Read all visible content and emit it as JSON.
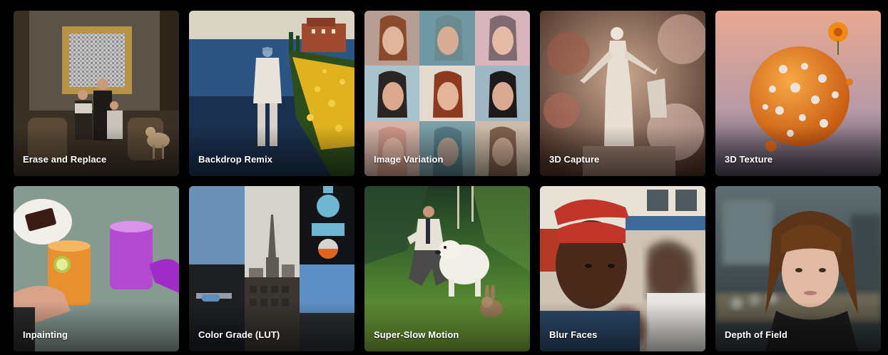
{
  "tools": [
    {
      "label": "Erase and Replace"
    },
    {
      "label": "Backdrop Remix"
    },
    {
      "label": "Image Variation"
    },
    {
      "label": "3D Capture"
    },
    {
      "label": "3D Texture"
    },
    {
      "label": "Inpainting"
    },
    {
      "label": "Color Grade (LUT)"
    },
    {
      "label": "Super-Slow Motion"
    },
    {
      "label": "Blur Faces"
    },
    {
      "label": "Depth of Field"
    }
  ]
}
